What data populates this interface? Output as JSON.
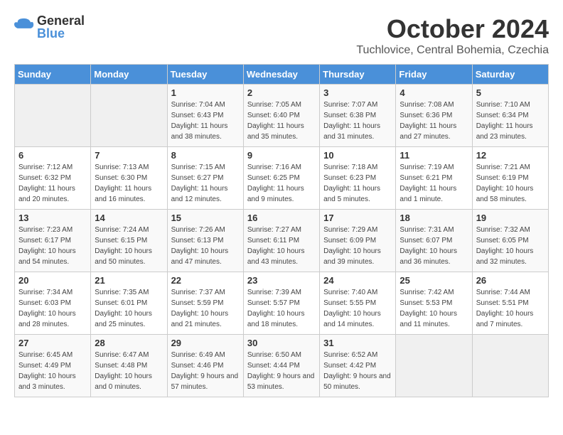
{
  "logo": {
    "general": "General",
    "blue": "Blue"
  },
  "title": "October 2024",
  "location": "Tuchlovice, Central Bohemia, Czechia",
  "days_of_week": [
    "Sunday",
    "Monday",
    "Tuesday",
    "Wednesday",
    "Thursday",
    "Friday",
    "Saturday"
  ],
  "weeks": [
    [
      {
        "day": "",
        "sunrise": "",
        "sunset": "",
        "daylight": ""
      },
      {
        "day": "",
        "sunrise": "",
        "sunset": "",
        "daylight": ""
      },
      {
        "day": "1",
        "sunrise": "Sunrise: 7:04 AM",
        "sunset": "Sunset: 6:43 PM",
        "daylight": "Daylight: 11 hours and 38 minutes."
      },
      {
        "day": "2",
        "sunrise": "Sunrise: 7:05 AM",
        "sunset": "Sunset: 6:40 PM",
        "daylight": "Daylight: 11 hours and 35 minutes."
      },
      {
        "day": "3",
        "sunrise": "Sunrise: 7:07 AM",
        "sunset": "Sunset: 6:38 PM",
        "daylight": "Daylight: 11 hours and 31 minutes."
      },
      {
        "day": "4",
        "sunrise": "Sunrise: 7:08 AM",
        "sunset": "Sunset: 6:36 PM",
        "daylight": "Daylight: 11 hours and 27 minutes."
      },
      {
        "day": "5",
        "sunrise": "Sunrise: 7:10 AM",
        "sunset": "Sunset: 6:34 PM",
        "daylight": "Daylight: 11 hours and 23 minutes."
      }
    ],
    [
      {
        "day": "6",
        "sunrise": "Sunrise: 7:12 AM",
        "sunset": "Sunset: 6:32 PM",
        "daylight": "Daylight: 11 hours and 20 minutes."
      },
      {
        "day": "7",
        "sunrise": "Sunrise: 7:13 AM",
        "sunset": "Sunset: 6:30 PM",
        "daylight": "Daylight: 11 hours and 16 minutes."
      },
      {
        "day": "8",
        "sunrise": "Sunrise: 7:15 AM",
        "sunset": "Sunset: 6:27 PM",
        "daylight": "Daylight: 11 hours and 12 minutes."
      },
      {
        "day": "9",
        "sunrise": "Sunrise: 7:16 AM",
        "sunset": "Sunset: 6:25 PM",
        "daylight": "Daylight: 11 hours and 9 minutes."
      },
      {
        "day": "10",
        "sunrise": "Sunrise: 7:18 AM",
        "sunset": "Sunset: 6:23 PM",
        "daylight": "Daylight: 11 hours and 5 minutes."
      },
      {
        "day": "11",
        "sunrise": "Sunrise: 7:19 AM",
        "sunset": "Sunset: 6:21 PM",
        "daylight": "Daylight: 11 hours and 1 minute."
      },
      {
        "day": "12",
        "sunrise": "Sunrise: 7:21 AM",
        "sunset": "Sunset: 6:19 PM",
        "daylight": "Daylight: 10 hours and 58 minutes."
      }
    ],
    [
      {
        "day": "13",
        "sunrise": "Sunrise: 7:23 AM",
        "sunset": "Sunset: 6:17 PM",
        "daylight": "Daylight: 10 hours and 54 minutes."
      },
      {
        "day": "14",
        "sunrise": "Sunrise: 7:24 AM",
        "sunset": "Sunset: 6:15 PM",
        "daylight": "Daylight: 10 hours and 50 minutes."
      },
      {
        "day": "15",
        "sunrise": "Sunrise: 7:26 AM",
        "sunset": "Sunset: 6:13 PM",
        "daylight": "Daylight: 10 hours and 47 minutes."
      },
      {
        "day": "16",
        "sunrise": "Sunrise: 7:27 AM",
        "sunset": "Sunset: 6:11 PM",
        "daylight": "Daylight: 10 hours and 43 minutes."
      },
      {
        "day": "17",
        "sunrise": "Sunrise: 7:29 AM",
        "sunset": "Sunset: 6:09 PM",
        "daylight": "Daylight: 10 hours and 39 minutes."
      },
      {
        "day": "18",
        "sunrise": "Sunrise: 7:31 AM",
        "sunset": "Sunset: 6:07 PM",
        "daylight": "Daylight: 10 hours and 36 minutes."
      },
      {
        "day": "19",
        "sunrise": "Sunrise: 7:32 AM",
        "sunset": "Sunset: 6:05 PM",
        "daylight": "Daylight: 10 hours and 32 minutes."
      }
    ],
    [
      {
        "day": "20",
        "sunrise": "Sunrise: 7:34 AM",
        "sunset": "Sunset: 6:03 PM",
        "daylight": "Daylight: 10 hours and 28 minutes."
      },
      {
        "day": "21",
        "sunrise": "Sunrise: 7:35 AM",
        "sunset": "Sunset: 6:01 PM",
        "daylight": "Daylight: 10 hours and 25 minutes."
      },
      {
        "day": "22",
        "sunrise": "Sunrise: 7:37 AM",
        "sunset": "Sunset: 5:59 PM",
        "daylight": "Daylight: 10 hours and 21 minutes."
      },
      {
        "day": "23",
        "sunrise": "Sunrise: 7:39 AM",
        "sunset": "Sunset: 5:57 PM",
        "daylight": "Daylight: 10 hours and 18 minutes."
      },
      {
        "day": "24",
        "sunrise": "Sunrise: 7:40 AM",
        "sunset": "Sunset: 5:55 PM",
        "daylight": "Daylight: 10 hours and 14 minutes."
      },
      {
        "day": "25",
        "sunrise": "Sunrise: 7:42 AM",
        "sunset": "Sunset: 5:53 PM",
        "daylight": "Daylight: 10 hours and 11 minutes."
      },
      {
        "day": "26",
        "sunrise": "Sunrise: 7:44 AM",
        "sunset": "Sunset: 5:51 PM",
        "daylight": "Daylight: 10 hours and 7 minutes."
      }
    ],
    [
      {
        "day": "27",
        "sunrise": "Sunrise: 6:45 AM",
        "sunset": "Sunset: 4:49 PM",
        "daylight": "Daylight: 10 hours and 3 minutes."
      },
      {
        "day": "28",
        "sunrise": "Sunrise: 6:47 AM",
        "sunset": "Sunset: 4:48 PM",
        "daylight": "Daylight: 10 hours and 0 minutes."
      },
      {
        "day": "29",
        "sunrise": "Sunrise: 6:49 AM",
        "sunset": "Sunset: 4:46 PM",
        "daylight": "Daylight: 9 hours and 57 minutes."
      },
      {
        "day": "30",
        "sunrise": "Sunrise: 6:50 AM",
        "sunset": "Sunset: 4:44 PM",
        "daylight": "Daylight: 9 hours and 53 minutes."
      },
      {
        "day": "31",
        "sunrise": "Sunrise: 6:52 AM",
        "sunset": "Sunset: 4:42 PM",
        "daylight": "Daylight: 9 hours and 50 minutes."
      },
      {
        "day": "",
        "sunrise": "",
        "sunset": "",
        "daylight": ""
      },
      {
        "day": "",
        "sunrise": "",
        "sunset": "",
        "daylight": ""
      }
    ]
  ]
}
